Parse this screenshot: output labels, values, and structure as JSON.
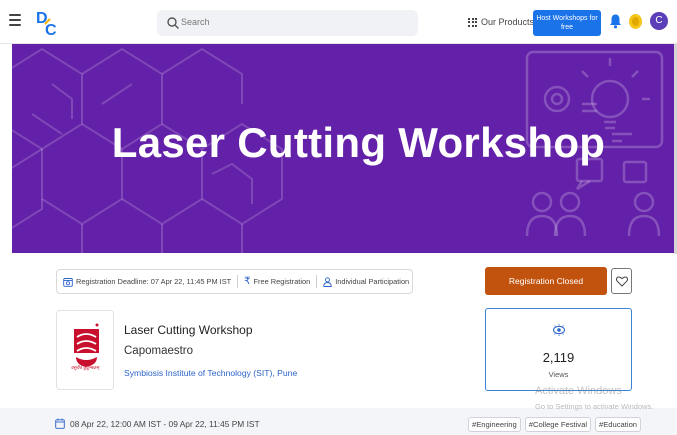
{
  "header": {
    "logo": "DC",
    "search_placeholder": "Search",
    "products_label": "Our Products",
    "host_button": "Host Workshops for free",
    "avatar_initial": "C",
    "icons": [
      "menu-icon",
      "search-icon",
      "grid-icon",
      "bell-icon",
      "coin-icon"
    ]
  },
  "banner": {
    "title": "Laser Cutting Workshop",
    "background_color": "#6320a8"
  },
  "info": {
    "deadline": "Registration Deadline: 07 Apr 22, 11:45 PM IST",
    "fee": "Free Registration",
    "participation": "Individual Participation"
  },
  "actions": {
    "registration_label": "Registration Closed",
    "registration_color": "#c2530f"
  },
  "event": {
    "title": "Laser Cutting Workshop",
    "organizer": "Capomaestro",
    "institute": "Symbiosis Institute of Technology (SIT), Pune",
    "logo_caption": "वसुधैव कुटुम्बकम्"
  },
  "stats": {
    "views_count": "2,119",
    "views_label": "Views"
  },
  "schedule": {
    "dates": "08 Apr 22, 12:00 AM IST - 09 Apr 22, 11:45 PM IST"
  },
  "tags": [
    "#Engineering",
    "#College Festival",
    "#Education"
  ],
  "watermark": {
    "line1": "Activate Windows",
    "line2": "Go to Settings to activate Windows."
  }
}
